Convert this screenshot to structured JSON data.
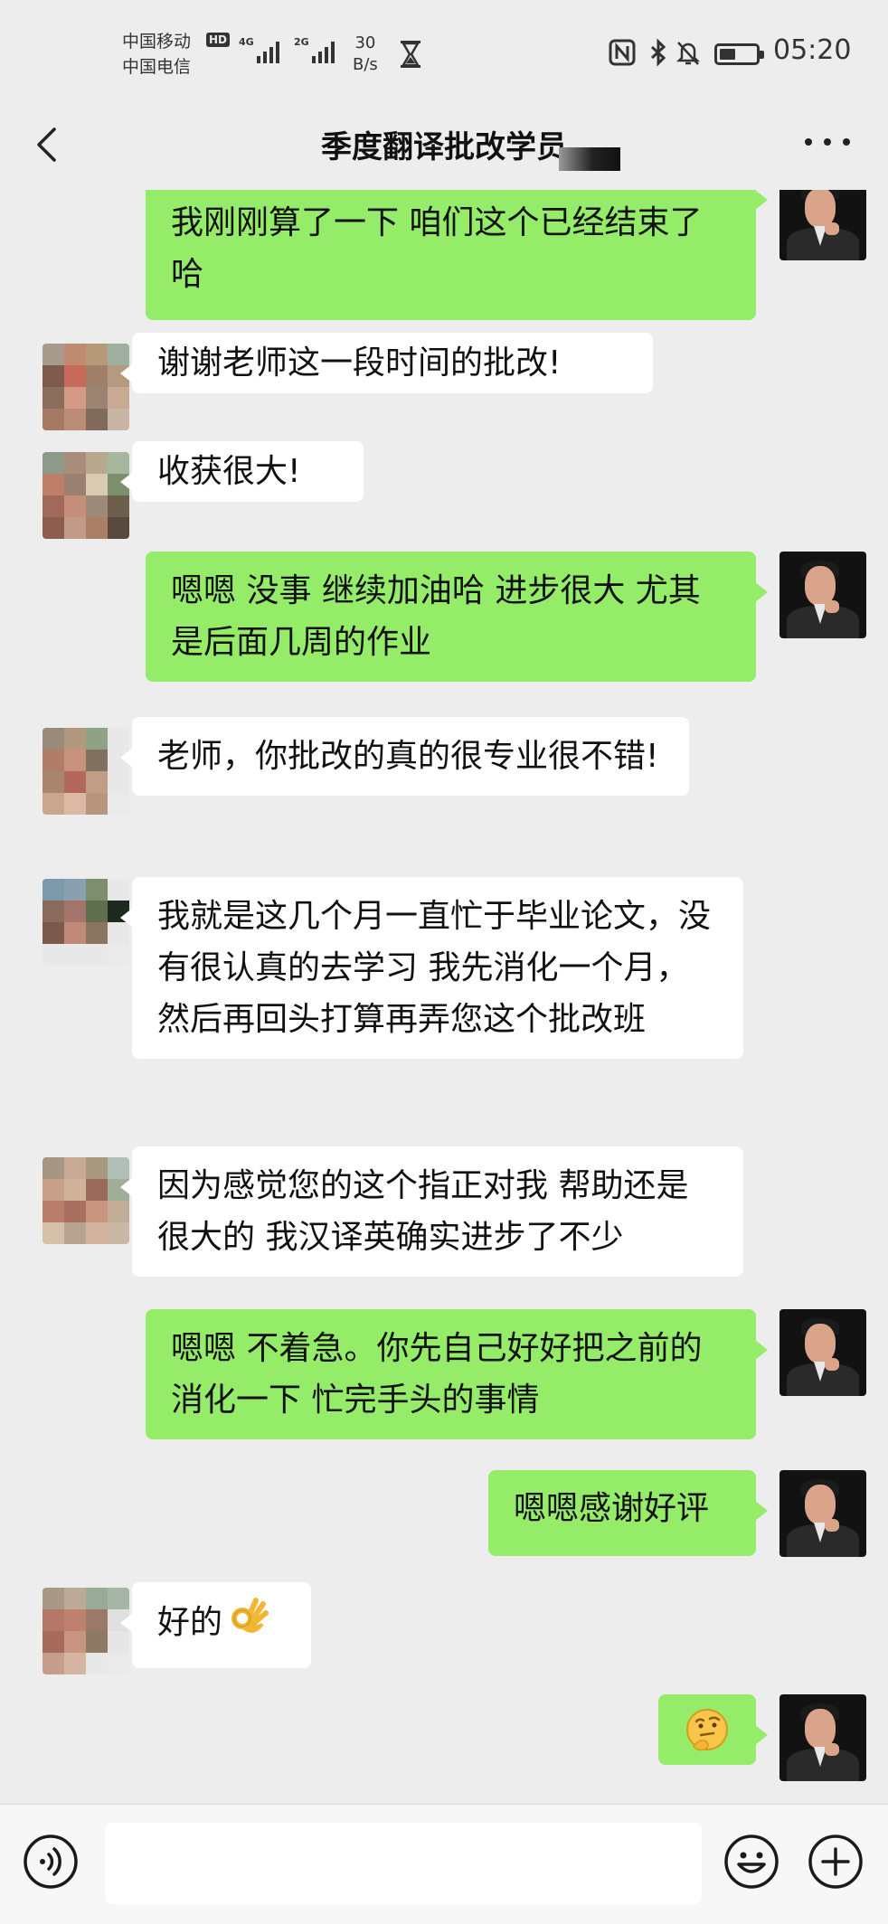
{
  "status_bar": {
    "carrier_1": "中国移动",
    "carrier_2": "中国电信",
    "hd_badge": "HD",
    "signal_1_tag": "4G",
    "signal_2_tag": "2G",
    "net_speed_value": "30",
    "net_speed_unit": "B/s",
    "battery_level": 0.45,
    "time": "05:20",
    "icons": [
      "nfc-icon",
      "bluetooth-icon",
      "mute-bell-icon",
      "battery-icon"
    ]
  },
  "nav": {
    "title": "季度翻译批改学员",
    "back_icon": "chevron-left-icon",
    "more_icon": "more-dots-icon"
  },
  "messages": [
    {
      "side": "out",
      "text": "我刚刚算了一下 咱们这个已经结束了哈"
    },
    {
      "side": "in",
      "text": "谢谢老师这一段时间的批改!"
    },
    {
      "side": "in",
      "text": "收获很大!"
    },
    {
      "side": "out",
      "text": "嗯嗯 没事 继续加油哈 进步很大 尤其是后面几周的作业"
    },
    {
      "side": "in",
      "text": "老师，你批改的真的很专业很不错!"
    },
    {
      "side": "in",
      "text": "我就是这几个月一直忙于毕业论文，没有很认真的去学习 我先消化一个月，然后再回头打算再弄您这个批改班"
    },
    {
      "side": "in",
      "text": "因为感觉您的这个指正对我 帮助还是很大的 我汉译英确实进步了不少"
    },
    {
      "side": "out",
      "text": "嗯嗯 不着急。你先自己好好把之前的消化一下 忙完手头的事情"
    },
    {
      "side": "out",
      "text": "嗯嗯感谢好评"
    },
    {
      "side": "in",
      "text": "好的",
      "emoji": "ok-hand-emoji"
    },
    {
      "side": "out",
      "text": "",
      "emoji": "thinking-face-emoji"
    }
  ],
  "input_bar": {
    "voice_icon": "voice-icon",
    "emoji_icon": "smile-icon",
    "plus_icon": "plus-icon"
  }
}
